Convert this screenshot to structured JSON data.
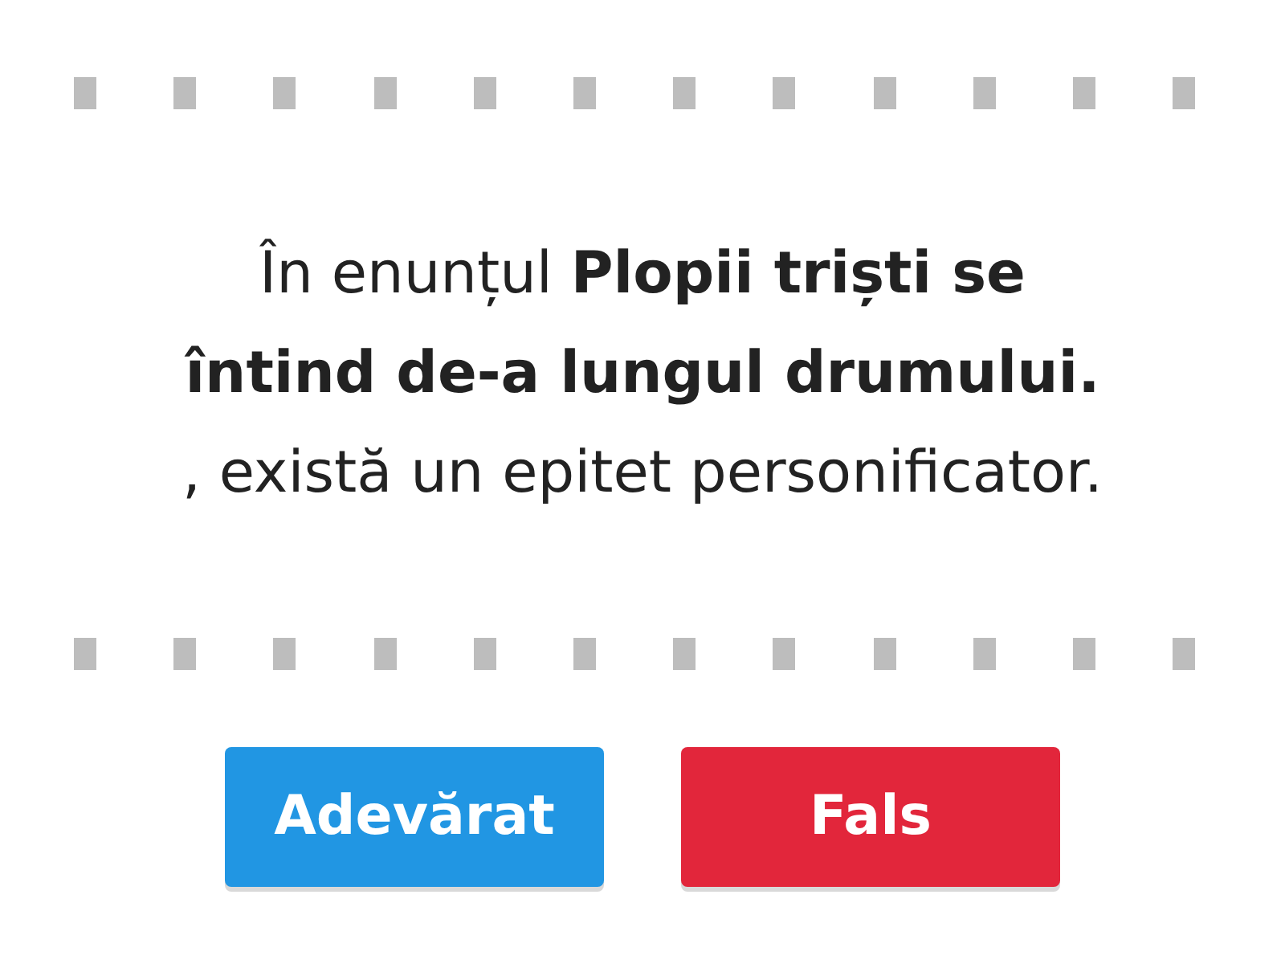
{
  "question": {
    "text": "În enunțul **Plopii triști se întind de-a lungul drumului.** , există un epitet personificator."
  },
  "answers": [
    {
      "label": "Adevărat",
      "color": "#2196e3"
    },
    {
      "label": "Fals",
      "color": "#e2263b"
    }
  ]
}
